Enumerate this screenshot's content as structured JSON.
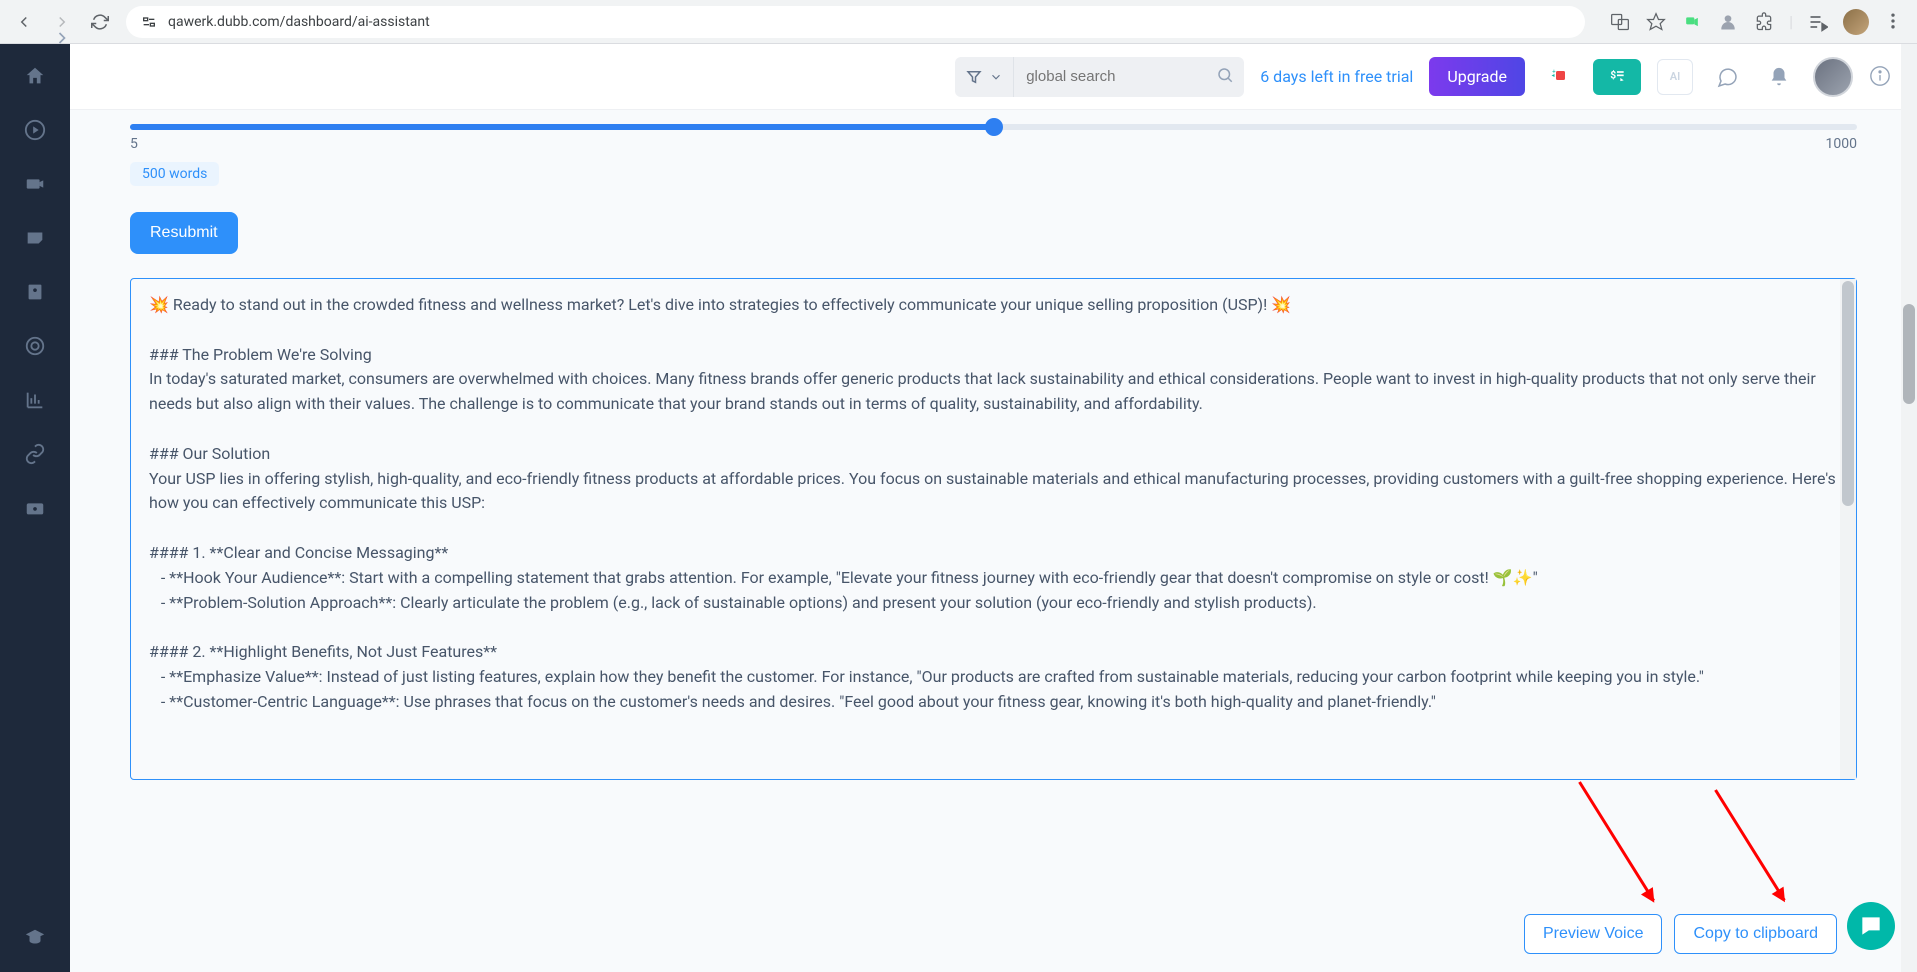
{
  "browser": {
    "url": "qawerk.dubb.com/dashboard/ai-assistant"
  },
  "topbar": {
    "search_placeholder": "global search",
    "trial_text": "6 days left in free trial",
    "upgrade_label": "Upgrade"
  },
  "slider": {
    "min": "5",
    "max": "1000",
    "value_label": "500 words"
  },
  "buttons": {
    "resubmit": "Resubmit",
    "preview_voice": "Preview Voice",
    "copy_clipboard": "Copy to clipboard"
  },
  "output": {
    "text": "💥 Ready to stand out in the crowded fitness and wellness market? Let's dive into strategies to effectively communicate your unique selling proposition (USP)! 💥\n\n### The Problem We're Solving\nIn today's saturated market, consumers are overwhelmed with choices. Many fitness brands offer generic products that lack sustainability and ethical considerations. People want to invest in high-quality products that not only serve their needs but also align with their values. The challenge is to communicate that your brand stands out in terms of quality, sustainability, and affordability.\n\n### Our Solution\nYour USP lies in offering stylish, high-quality, and eco-friendly fitness products at affordable prices. You focus on sustainable materials and ethical manufacturing processes, providing customers with a guilt-free shopping experience. Here's how you can effectively communicate this USP:\n\n#### 1. **Clear and Concise Messaging**\n   - **Hook Your Audience**: Start with a compelling statement that grabs attention. For example, \"Elevate your fitness journey with eco-friendly gear that doesn't compromise on style or cost! 🌱✨\"\n   - **Problem-Solution Approach**: Clearly articulate the problem (e.g., lack of sustainable options) and present your solution (your eco-friendly and stylish products).\n\n#### 2. **Highlight Benefits, Not Just Features**\n   - **Emphasize Value**: Instead of just listing features, explain how they benefit the customer. For instance, \"Our products are crafted from sustainable materials, reducing your carbon footprint while keeping you in style.\"\n   - **Customer-Centric Language**: Use phrases that focus on the customer's needs and desires. \"Feel good about your fitness gear, knowing it's both high-quality and planet-friendly.\""
  }
}
